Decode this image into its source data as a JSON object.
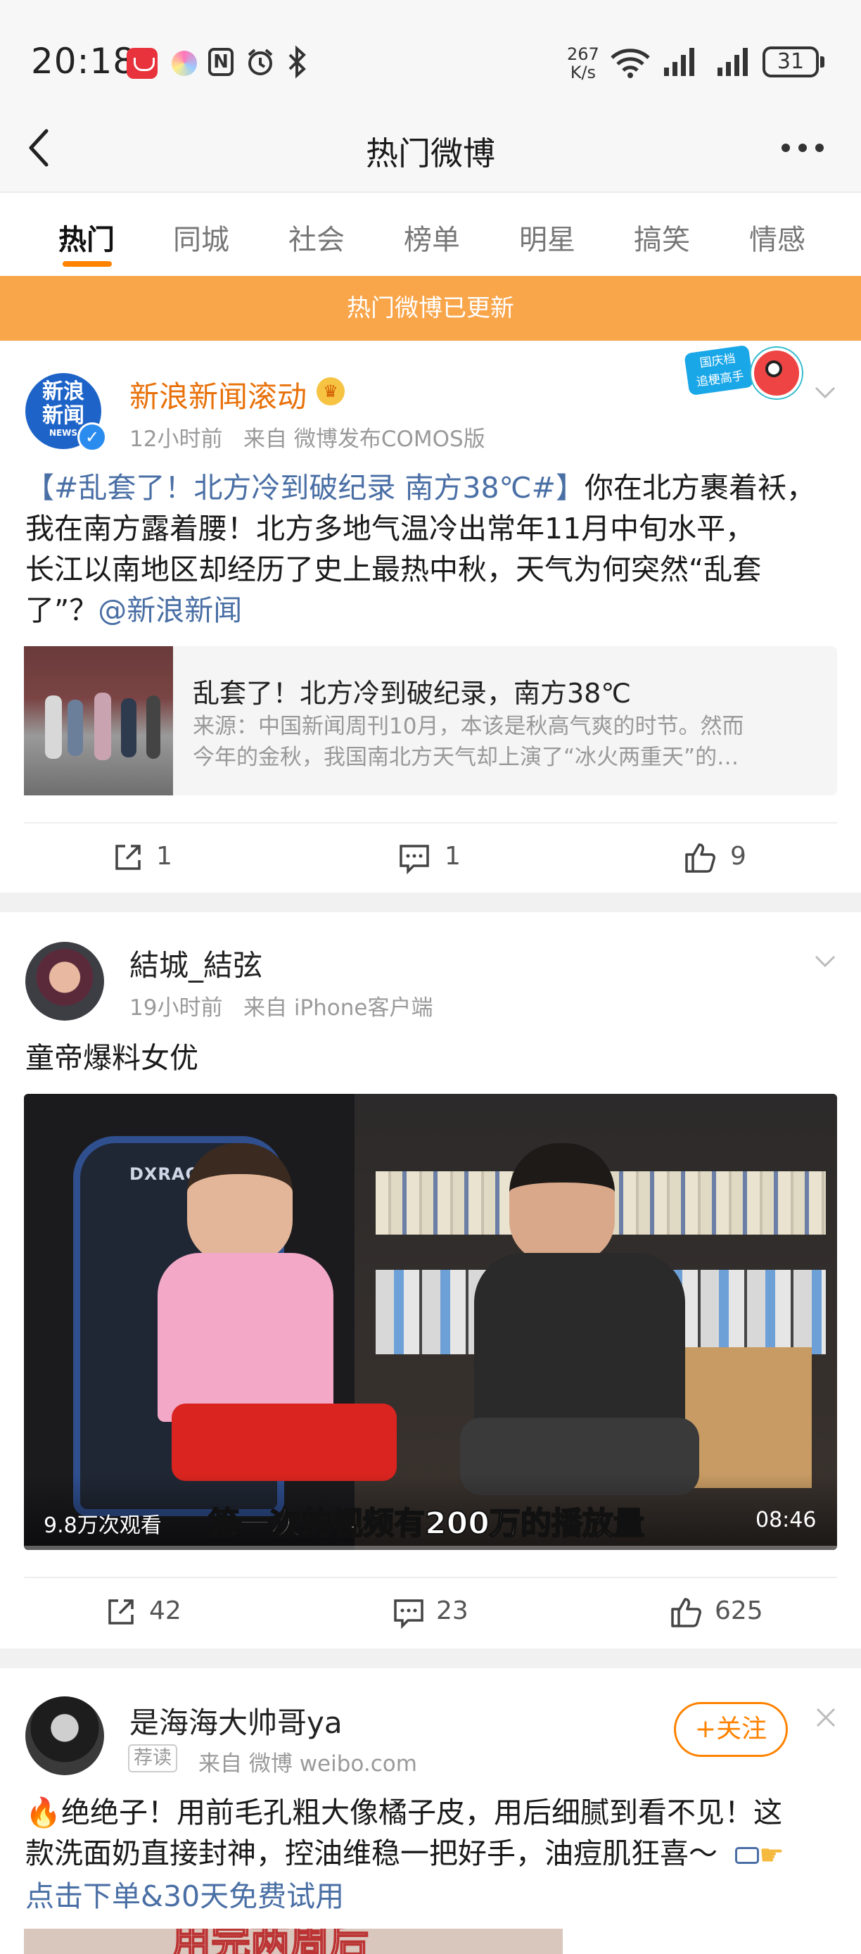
{
  "status_bar": {
    "time": "20:18",
    "net_speed_top": "267",
    "net_speed_bottom": "K/s",
    "battery": "31",
    "icons": [
      "huawei-appgallery-icon",
      "color-circle-icon",
      "nfc-icon",
      "alarm-icon",
      "bluetooth-icon",
      "wifi-icon",
      "signal-icon",
      "signal-icon",
      "battery-icon"
    ]
  },
  "header": {
    "title": "热门微博",
    "back_icon": "back-arrow-icon",
    "more_icon": "more-dots-icon"
  },
  "tabs": [
    "热门",
    "同城",
    "社会",
    "榜单",
    "明星",
    "搞笑",
    "情感"
  ],
  "banner": "热门微博已更新",
  "posts": [
    {
      "author": "新浪新闻滚动",
      "avatar_text_1": "新浪",
      "avatar_text_2": "新闻",
      "avatar_text_3": "NEWS",
      "time": "12小时前",
      "source": "来自 微博发布COMOS版",
      "text_hashtag": "【#乱套了！北方冷到破纪录 南方38℃#】",
      "text_line1_rest": "你在北方裹着袄，",
      "text_line2": "我在南方露着腰！北方多地气温冷出常年11月中旬水平，",
      "text_line3": "长江以南地区却经历了史上最热中秋，天气为何突然“乱套",
      "text_line4": "了”？",
      "mention": "@新浪新闻",
      "sticker_line1": "国庆档",
      "sticker_line2": "追梗高手",
      "card_title": "乱套了！北方冷到破纪录，南方38℃",
      "card_desc_line1": "来源：中国新闻周刊10月，本该是秋高气爽的时节。然而",
      "card_desc_line2": "今年的金秋，我国南北方天气却上演了“冰火两重天”的…",
      "reposts": "1",
      "comments": "1",
      "likes": "9"
    },
    {
      "author": "結城_結弦",
      "time": "19小时前",
      "source": "来自 iPhone客户端",
      "text": "童帝爆料女优",
      "views": "9.8万次观看",
      "subtitle": "第一次的视频有200万的播放量",
      "duration": "08:46",
      "chair_brand": "DXRACER",
      "reposts": "42",
      "comments": "23",
      "likes": "625"
    },
    {
      "author": "是海海大帅哥ya",
      "tag": "荐读",
      "source": "来自 微博 weibo.com",
      "follow": "+关注",
      "text_line1": "🔥绝绝子！用前毛孔粗大像橘子皮，用后细腻到看不见！这",
      "text_line2": "款洗面奶直接封神，控油维稳一把好手，油痘肌狂喜～",
      "link": "点击下单&30天免费试用",
      "image_text": "用完两周后"
    }
  ],
  "colors": {
    "accent": "#ff8200",
    "banner": "#f9a54a",
    "link": "#4a6fa5",
    "vip_name": "#e8710a"
  }
}
